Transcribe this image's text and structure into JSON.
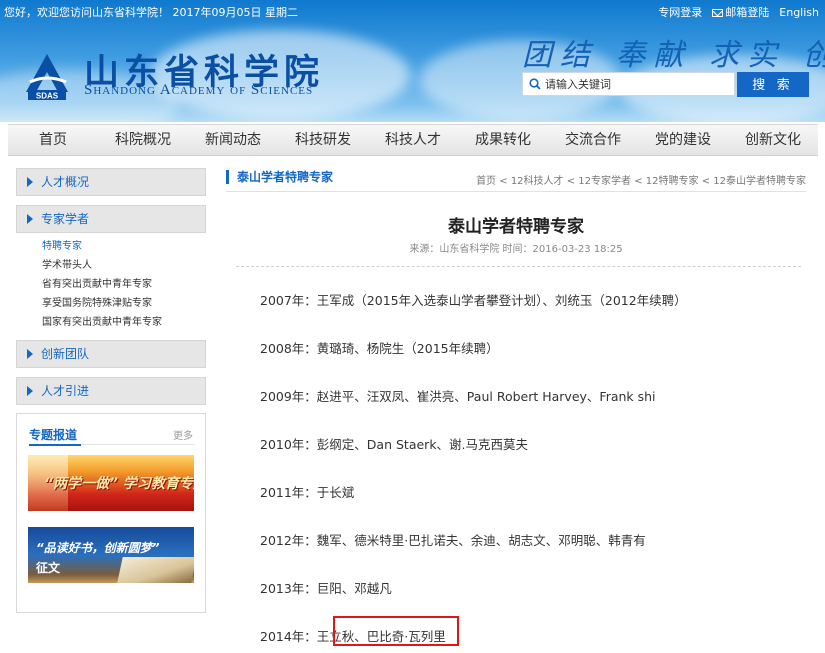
{
  "header": {
    "greeting": "您好，欢迎您访问山东省科学院！ 2017年09月05日 星期二",
    "top_links": {
      "intranet_login": "专网登录",
      "mail_login": "邮箱登陆",
      "english": "English"
    },
    "logo": {
      "name_cn": "山东省科学院",
      "name_en": "Shandong Academy of Sciences",
      "abbr": "SDAS"
    },
    "motto": "团结 奉献 求实 创新",
    "search": {
      "placeholder": "请输入关键词",
      "button_label": "搜 索"
    }
  },
  "nav": {
    "items": [
      "首页",
      "科院概况",
      "新闻动态",
      "科技研发",
      "科技人才",
      "成果转化",
      "交流合作",
      "党的建设",
      "创新文化"
    ]
  },
  "sidebar": {
    "sections": [
      {
        "label": "人才概况"
      },
      {
        "label": "专家学者",
        "children": [
          "特聘专家",
          "学术带头人",
          "省有突出贡献中青年专家",
          "享受国务院特殊津贴专家",
          "国家有突出贡献中青年专家"
        ]
      },
      {
        "label": "创新团队"
      },
      {
        "label": "人才引进"
      }
    ],
    "active_child": "特聘专家",
    "special_reports": {
      "title": "专题报道",
      "more": "更多",
      "banners": [
        {
          "text": "“两学一做” 学习教育专题"
        },
        {
          "text_line1": "“品读好书，创新圆梦”",
          "text_line2": "征文"
        }
      ]
    }
  },
  "main": {
    "section_title": "泰山学者特聘专家",
    "breadcrumb": [
      "首页",
      "12科技人才",
      "12专家学者",
      "12特聘专家",
      "12泰山学者特聘专家"
    ],
    "breadcrumb_sep": " < ",
    "article": {
      "title": "泰山学者特聘专家",
      "meta": "来源：山东省科学院 时间：2016-03-23 18:25",
      "entries": [
        "2007年：王军成（2015年入选泰山学者攀登计划）、刘统玉（2012年续聘）",
        "2008年：黄璐琦、杨院生（2015年续聘）",
        "2009年：赵进平、汪双凤、崔洪亮、Paul Robert Harvey、Frank shi",
        "2010年：彭纲定、Dan Staerk、谢.马克西莫夫",
        "2011年：于长斌",
        "2012年：魏军、德米特里·巴扎诺夫、余迪、胡志文、邓明聪、韩青有",
        "2013年：巨阳、邓越凡",
        "2014年：王立秋、巴比奇·瓦列里"
      ]
    }
  },
  "colors": {
    "brand_blue": "#1467c4",
    "header_logo_blue": "#0a4fa3",
    "highlight_red": "#e0161b"
  }
}
